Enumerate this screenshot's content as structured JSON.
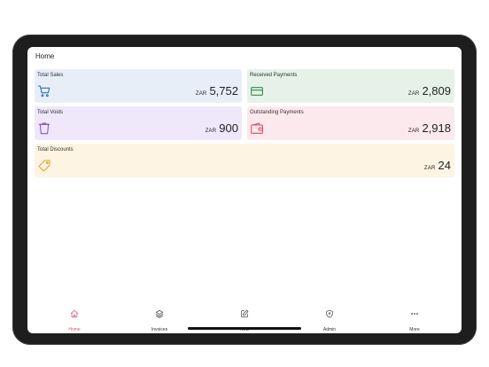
{
  "header": {
    "title": "Home"
  },
  "currency": "ZAR",
  "cards": [
    {
      "label": "Total Sales",
      "icon": "shopping-cart-icon",
      "value": "5,752",
      "bg": "#e8eef8",
      "iconColor": "#2b6fb0"
    },
    {
      "label": "Received Payments",
      "icon": "credit-card-icon",
      "value": "2,809",
      "bg": "#e6f2e9",
      "iconColor": "#2f8a46"
    },
    {
      "label": "Total Voids",
      "icon": "trash-icon",
      "value": "900",
      "bg": "#eee8fa",
      "iconColor": "#8a4fd0"
    },
    {
      "label": "Outstanding Payments",
      "icon": "wallet-icon",
      "value": "2,918",
      "bg": "#fbe9ee",
      "iconColor": "#d94a5e"
    },
    {
      "label": "Total Discounts",
      "icon": "tag-icon",
      "value": "24",
      "bg": "#fdf4e3",
      "iconColor": "#e0a531"
    }
  ],
  "tabs": [
    {
      "label": "Home",
      "icon": "home-icon",
      "active": true
    },
    {
      "label": "Invoices",
      "icon": "layers-icon",
      "active": false
    },
    {
      "label": "New",
      "icon": "edit-icon",
      "active": false
    },
    {
      "label": "Admin",
      "icon": "shield-icon",
      "active": false
    },
    {
      "label": "More",
      "icon": "more-icon",
      "active": false
    }
  ],
  "colors": {
    "active": "#e0506b",
    "inactive": "#444444"
  }
}
